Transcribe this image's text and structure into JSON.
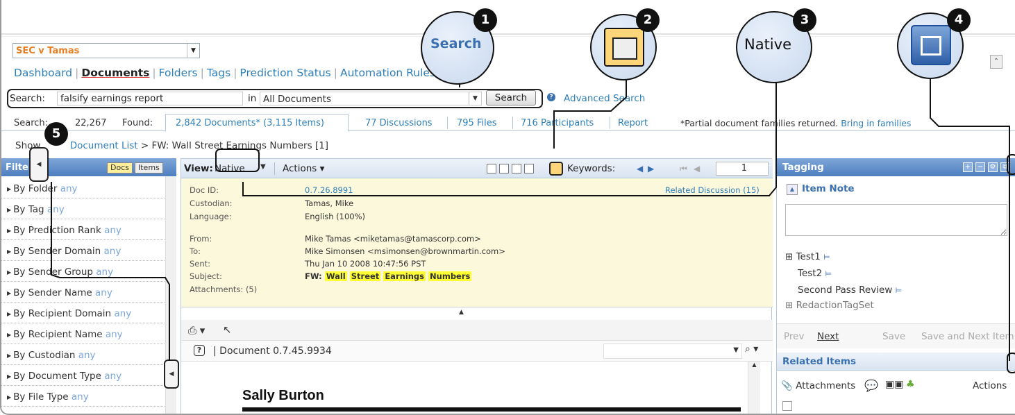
{
  "header": {
    "case_name": "SEC v Tamas",
    "nav": [
      "Dashboard",
      "Documents",
      "Folders",
      "Tags",
      "Prediction Status",
      "Automation Rules"
    ],
    "nav_active": "Documents"
  },
  "search": {
    "label": "Search:",
    "query": "falsify earnings report",
    "in_label": "in",
    "scope": "All Documents",
    "button": "Search",
    "advanced": "Advanced Search"
  },
  "stats": {
    "searched_label": "Search:",
    "searched_value": "22,267",
    "found_label": "Found:",
    "tabs": [
      "2,842 Documents* (3,115 Items)",
      "77 Discussions",
      "795 Files",
      "716 Participants",
      "Report"
    ],
    "partial_note": "*Partial document families returned.",
    "bring_in": "Bring in families"
  },
  "breadcrumb": {
    "prefix": "Show",
    "list": "Document List",
    "current": "FW: Wall Street Earnings Numbers [1]"
  },
  "filter_panel": {
    "title": "Filters",
    "toggle_docs": "Docs",
    "toggle_items": "Items",
    "items": [
      {
        "label": "By Folder",
        "value": "any"
      },
      {
        "label": "By Tag",
        "value": "any"
      },
      {
        "label": "By Prediction Rank",
        "value": "any"
      },
      {
        "label": "By Sender Domain",
        "value": "any"
      },
      {
        "label": "By Sender Group",
        "value": "any"
      },
      {
        "label": "By Sender Name",
        "value": "any"
      },
      {
        "label": "By Recipient Domain",
        "value": "any"
      },
      {
        "label": "By Recipient Name",
        "value": "any"
      },
      {
        "label": "By Custodian",
        "value": "any"
      },
      {
        "label": "By Document Type",
        "value": "any"
      },
      {
        "label": "By File Type",
        "value": "any"
      }
    ]
  },
  "doc_toolbar": {
    "view_label": "View:",
    "view_value": "Native",
    "actions": "Actions",
    "keywords": "Keywords:",
    "page": "1"
  },
  "doc_meta": {
    "doc_id_label": "Doc ID:",
    "doc_id": "0.7.26.8991",
    "custodian_label": "Custodian:",
    "custodian": "Tamas, Mike",
    "language_label": "Language:",
    "language": "English (100%)",
    "from_label": "From:",
    "from": "Mike Tamas <miketamas@tamascorp.com>",
    "to_label": "To:",
    "to": "Mike Simonsen <msimonsen@brownmartin.com>",
    "sent_label": "Sent:",
    "sent": "Thu Jan 10 2008 10:47:56 PST",
    "subject_label": "Subject:",
    "subject_prefix": "FW:",
    "subject_words": [
      "Wall",
      "Street",
      "Earnings",
      "Numbers"
    ],
    "attachments_label": "Attachments: (5)",
    "related_discussion": "Related Discussion (15)"
  },
  "viewer": {
    "document_title": "Document 0.7.45.9934",
    "page_heading": "Sally Burton"
  },
  "tagging": {
    "title": "Tagging",
    "item_note": "Item Note",
    "tags": [
      "Test1",
      "Test2",
      "Second Pass Review",
      "RedactionTagSet"
    ],
    "prev": "Prev",
    "next": "Next",
    "save": "Save",
    "save_next": "Save and Next Item",
    "related_items": "Related Items",
    "attachments": "Attachments",
    "actions": "Actions"
  },
  "callouts": {
    "bubble_search": "Search",
    "bubble_native": "Native",
    "numbers": [
      "1",
      "2",
      "3",
      "4",
      "5"
    ]
  },
  "colors": {
    "accent": "#2f7fb8",
    "case_name": "#e67e22",
    "highlight": "#ffff33",
    "meta_background": "#fcf8dc",
    "panel_header": "#4f7fc0"
  }
}
